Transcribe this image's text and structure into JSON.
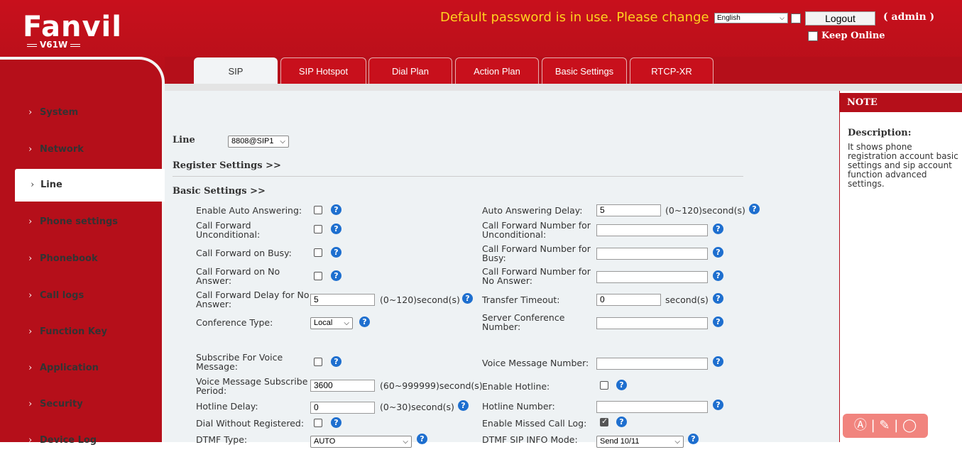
{
  "header": {
    "brand": "Fanvil",
    "model": "V61W",
    "warning": "Default password is in use. Please change",
    "language": "English",
    "logout": "Logout",
    "user": "( admin )",
    "keep_online": "Keep Online"
  },
  "sidebar": {
    "items": [
      {
        "label": "System"
      },
      {
        "label": "Network"
      },
      {
        "label": "Line"
      },
      {
        "label": "Phone settings"
      },
      {
        "label": "Phonebook"
      },
      {
        "label": "Call logs"
      },
      {
        "label": "Function Key"
      },
      {
        "label": "Application"
      },
      {
        "label": "Security"
      },
      {
        "label": "Device Log"
      }
    ],
    "active": "Line"
  },
  "tabs": [
    {
      "label": "SIP"
    },
    {
      "label": "SIP Hotspot"
    },
    {
      "label": "Dial Plan"
    },
    {
      "label": "Action Plan"
    },
    {
      "label": "Basic Settings"
    },
    {
      "label": "RTCP-XR"
    }
  ],
  "line": {
    "label": "Line",
    "value": "8808@SIP1"
  },
  "sections": {
    "register": "Register Settings >>",
    "basic": "Basic Settings >>"
  },
  "left_fields": {
    "auto_answer": "Enable Auto Answering:",
    "cf_uncond": "Call Forward Unconditional:",
    "cf_busy": "Call Forward on Busy:",
    "cf_noans": "Call Forward on No Answer:",
    "cf_delay": "Call Forward Delay for No Answer:",
    "cf_delay_val": "5",
    "cf_delay_unit": "(0~120)second(s)",
    "conf_type": "Conference Type:",
    "conf_type_val": "Local",
    "sub_voice": "Subscribe For Voice Message:",
    "vm_period": "Voice Message Subscribe Period:",
    "vm_period_val": "3600",
    "vm_period_unit": "(60~999999)second(s)",
    "hotline_delay": "Hotline Delay:",
    "hotline_delay_val": "0",
    "hotline_delay_unit": "(0~30)second(s)",
    "dial_wo_reg": "Dial Without Registered:",
    "dtmf_type": "DTMF Type:",
    "dtmf_type_val": "AUTO"
  },
  "right_fields": {
    "auto_delay": "Auto Answering Delay:",
    "auto_delay_val": "5",
    "auto_delay_unit": "(0~120)second(s)",
    "cfn_uncond": "Call Forward Number for Unconditional:",
    "cfn_busy": "Call Forward Number for Busy:",
    "cfn_noans": "Call Forward Number for No Answer:",
    "transfer_timeout": "Transfer Timeout:",
    "transfer_timeout_val": "0",
    "transfer_timeout_unit": "second(s)",
    "server_conf": "Server Conference Number:",
    "vm_number": "Voice Message Number:",
    "enable_hotline": "Enable Hotline:",
    "hotline_number": "Hotline Number:",
    "missed_log": "Enable Missed Call Log:",
    "dtmf_sip_info": "DTMF SIP INFO Mode:",
    "dtmf_sip_info_val": "Send 10/11"
  },
  "note": {
    "title": "NOTE",
    "desc_title": "Description:",
    "desc_text": "It shows phone registration account basic settings and sip account function advanced settings."
  },
  "help_glyph": "?",
  "colors": {
    "brand_red": "#b50f1a",
    "warning": "#ffd21f",
    "help_blue": "#1e6fcf"
  }
}
